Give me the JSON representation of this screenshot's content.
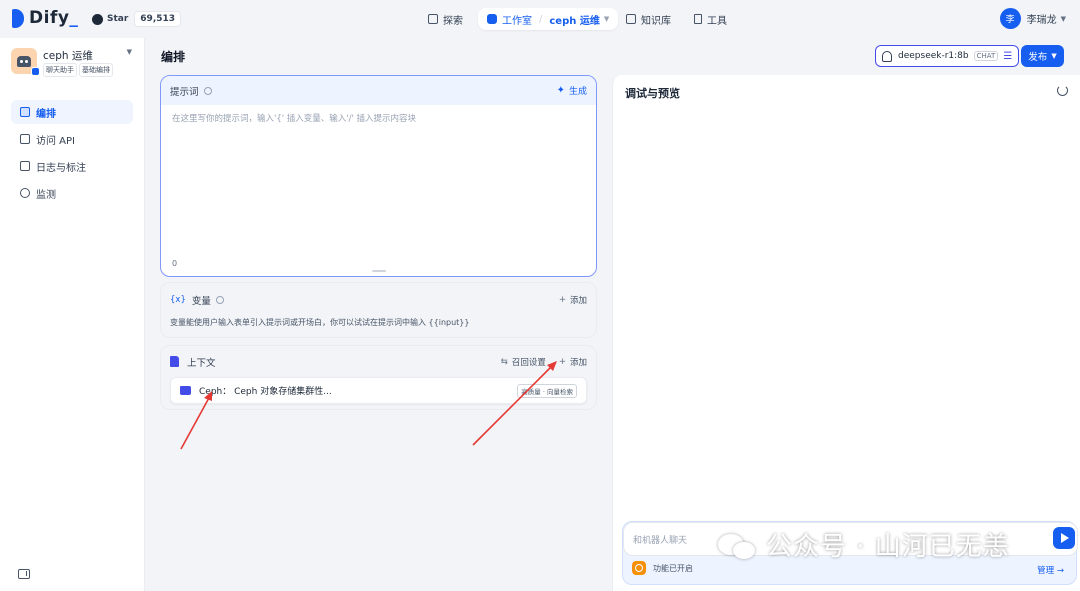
{
  "header": {
    "logo_text": "Dify",
    "github": {
      "label": "Star",
      "count": "69,513"
    },
    "nav": {
      "explore": "探索",
      "studio": "工作室",
      "app_name": "ceph 运维",
      "knowledge": "知识库",
      "tools": "工具"
    },
    "user": {
      "avatar": "李",
      "name": "李瑞龙"
    }
  },
  "sidebar": {
    "app": {
      "name": "ceph 运维",
      "tags": [
        "聊天助手",
        "基础编排"
      ]
    },
    "items": [
      {
        "label": "编排",
        "icon": "layout-icon"
      },
      {
        "label": "访问 API",
        "icon": "terminal-icon"
      },
      {
        "label": "日志与标注",
        "icon": "log-icon"
      },
      {
        "label": "监测",
        "icon": "monitor-icon"
      }
    ]
  },
  "main": {
    "title": "编排",
    "model": {
      "name": "deepseek-r1:8b",
      "mode": "CHAT"
    },
    "publish_label": "发布"
  },
  "prompt": {
    "title": "提示词",
    "generate_label": "生成",
    "placeholder": "在这里写你的提示词，输入'{' 插入变量、输入'/' 插入提示内容块",
    "char_count": "0"
  },
  "variables": {
    "title": "变量",
    "add_label": "添加",
    "description": "变量能使用户输入表单引入提示词或开场白，你可以试试在提示词中输入 {{input}}"
  },
  "context": {
    "title": "上下文",
    "recall_label": "召回设置",
    "add_label": "添加",
    "dataset": {
      "name": "Ceph：  Ceph 对象存储集群性...",
      "badge": "高质量 · 向量检索"
    }
  },
  "preview": {
    "title": "调试与预览",
    "input_placeholder": "和机器人聊天",
    "feature_label": "功能已开启",
    "manage_label": "管理 →"
  },
  "watermark": "公众号 · 山河已无恙",
  "colors": {
    "accent": "#155eef",
    "annotation": "#e53935"
  }
}
